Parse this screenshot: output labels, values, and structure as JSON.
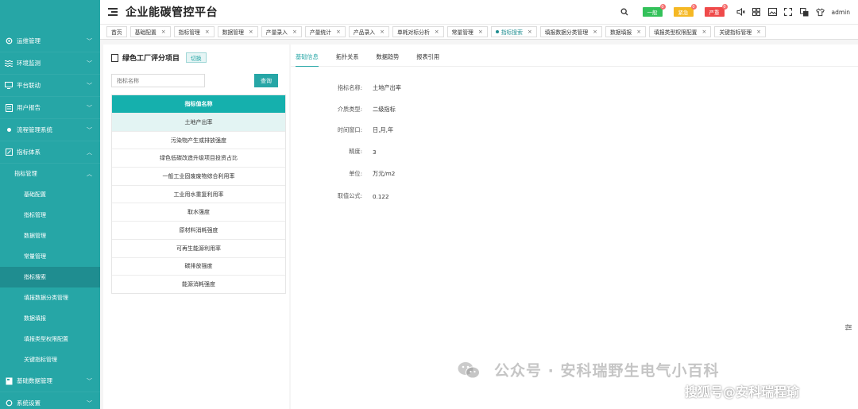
{
  "app": {
    "title": "企业能碳管控平台"
  },
  "header": {
    "badges": [
      {
        "label": "一般",
        "color": "#33c15a",
        "count": "0"
      },
      {
        "label": "紧急",
        "color": "#f5b824",
        "count": "0"
      },
      {
        "label": "严重",
        "color": "#ef4a4a",
        "count": "0"
      }
    ],
    "user": "admin"
  },
  "sidebar": {
    "items": [
      {
        "label": "运维管理",
        "icon": "gear-icon"
      },
      {
        "label": "环境监测",
        "icon": "wave-icon"
      },
      {
        "label": "平台联动",
        "icon": "monitor-icon"
      },
      {
        "label": "用户报告",
        "icon": "document-icon"
      },
      {
        "label": "流程管理系统",
        "icon": "flow-icon"
      },
      {
        "label": "指标体系",
        "icon": "edit-icon"
      }
    ],
    "sub_group": "指标管理",
    "leaves": [
      "基础配置",
      "指标管理",
      "数据管理",
      "常量管理",
      "指标搜索",
      "填报数据分类管理",
      "数据填报",
      "填报类型权限配置",
      "关键指标管理"
    ],
    "active_leaf": "指标搜索",
    "bottom_items": [
      {
        "label": "基础数据管理",
        "icon": "database-icon"
      },
      {
        "label": "系统设置",
        "icon": "settings-icon"
      }
    ]
  },
  "tabs": [
    {
      "label": "首页",
      "closable": false
    },
    {
      "label": "基础配置",
      "closable": true
    },
    {
      "label": "指标管理",
      "closable": true
    },
    {
      "label": "数据管理",
      "closable": true
    },
    {
      "label": "产量录入",
      "closable": true
    },
    {
      "label": "产量统计",
      "closable": true
    },
    {
      "label": "产品录入",
      "closable": true
    },
    {
      "label": "单耗对标分析",
      "closable": true
    },
    {
      "label": "常量管理",
      "closable": true
    },
    {
      "label": "指标搜索",
      "closable": true,
      "active": true
    },
    {
      "label": "填报数据分类管理",
      "closable": true
    },
    {
      "label": "数据填报",
      "closable": true
    },
    {
      "label": "填报类型权限配置",
      "closable": true
    },
    {
      "label": "关键指标管理",
      "closable": true
    }
  ],
  "left_panel": {
    "title": "绿色工厂评分项目",
    "switch_label": "切换",
    "search_placeholder": "指标名称",
    "search_button": "查询",
    "table_header": "指标值名称",
    "rows": [
      "土地产出率",
      "污染物产生或排放强度",
      "绿色低碳改造升级项目投资占比",
      "一般工业固废废物综合利用率",
      "工业用水重复利用率",
      "取水强度",
      "原材料消耗强度",
      "可再生能源利用率",
      "碳排放强度",
      "能源消耗强度"
    ],
    "selected_row": 0
  },
  "right_panel": {
    "tabs": [
      "基础信息",
      "拓扑关系",
      "数据趋势",
      "报表引用"
    ],
    "active_tab": 0,
    "fields": [
      {
        "label": "指标名称:",
        "value": "土地产出率"
      },
      {
        "label": "介质类型:",
        "value": "二级指标"
      },
      {
        "label": "时间窗口:",
        "value": "日,月,年"
      },
      {
        "label": "精度:",
        "value": "3"
      },
      {
        "label": "单位:",
        "value": "万元/m2"
      },
      {
        "label": "取值公式:",
        "value": "0.122"
      }
    ]
  },
  "watermarks": {
    "wechat": "公众号 · 安科瑞野生电气小百科",
    "sohu": "搜狐号@安科瑞程瑜"
  },
  "colors": {
    "sidebar": "#26a6a6",
    "accent": "#15b0ad",
    "active_leaf": "#1f8d90"
  }
}
